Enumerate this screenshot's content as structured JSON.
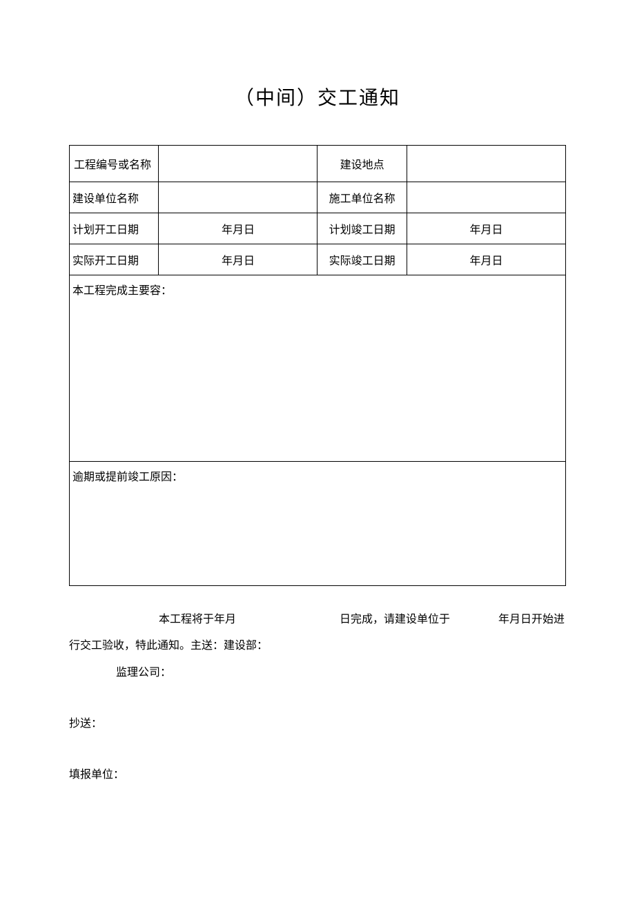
{
  "title": "（中间）交工通知",
  "table": {
    "row1": {
      "label1": "工程编号或名称",
      "value1": "",
      "label2": "建设地点",
      "value2": ""
    },
    "row2": {
      "label1": "建设单位名称",
      "value1": "",
      "label2": "施工单位名称",
      "value2": ""
    },
    "row3": {
      "label1": "计划开工日期",
      "value1": "年月日",
      "label2": "计划竣工日期",
      "value2": "年月日"
    },
    "row4": {
      "label1": "实际开工日期",
      "value1": "年月日",
      "label2": "实际竣工日期",
      "value2": "年月日"
    },
    "content_label": "本工程完成主要容：",
    "reason_label": "逾期或提前竣工原因："
  },
  "footer": {
    "part1": "本工程将于年月",
    "part2": "日完成，请建设单位于",
    "part3": "年月日开始进",
    "line2a": "行交工验收，特此通知。主送：建设部：",
    "line3": "监理公司：",
    "cc_label": "抄送：",
    "report_label": "填报单位："
  }
}
